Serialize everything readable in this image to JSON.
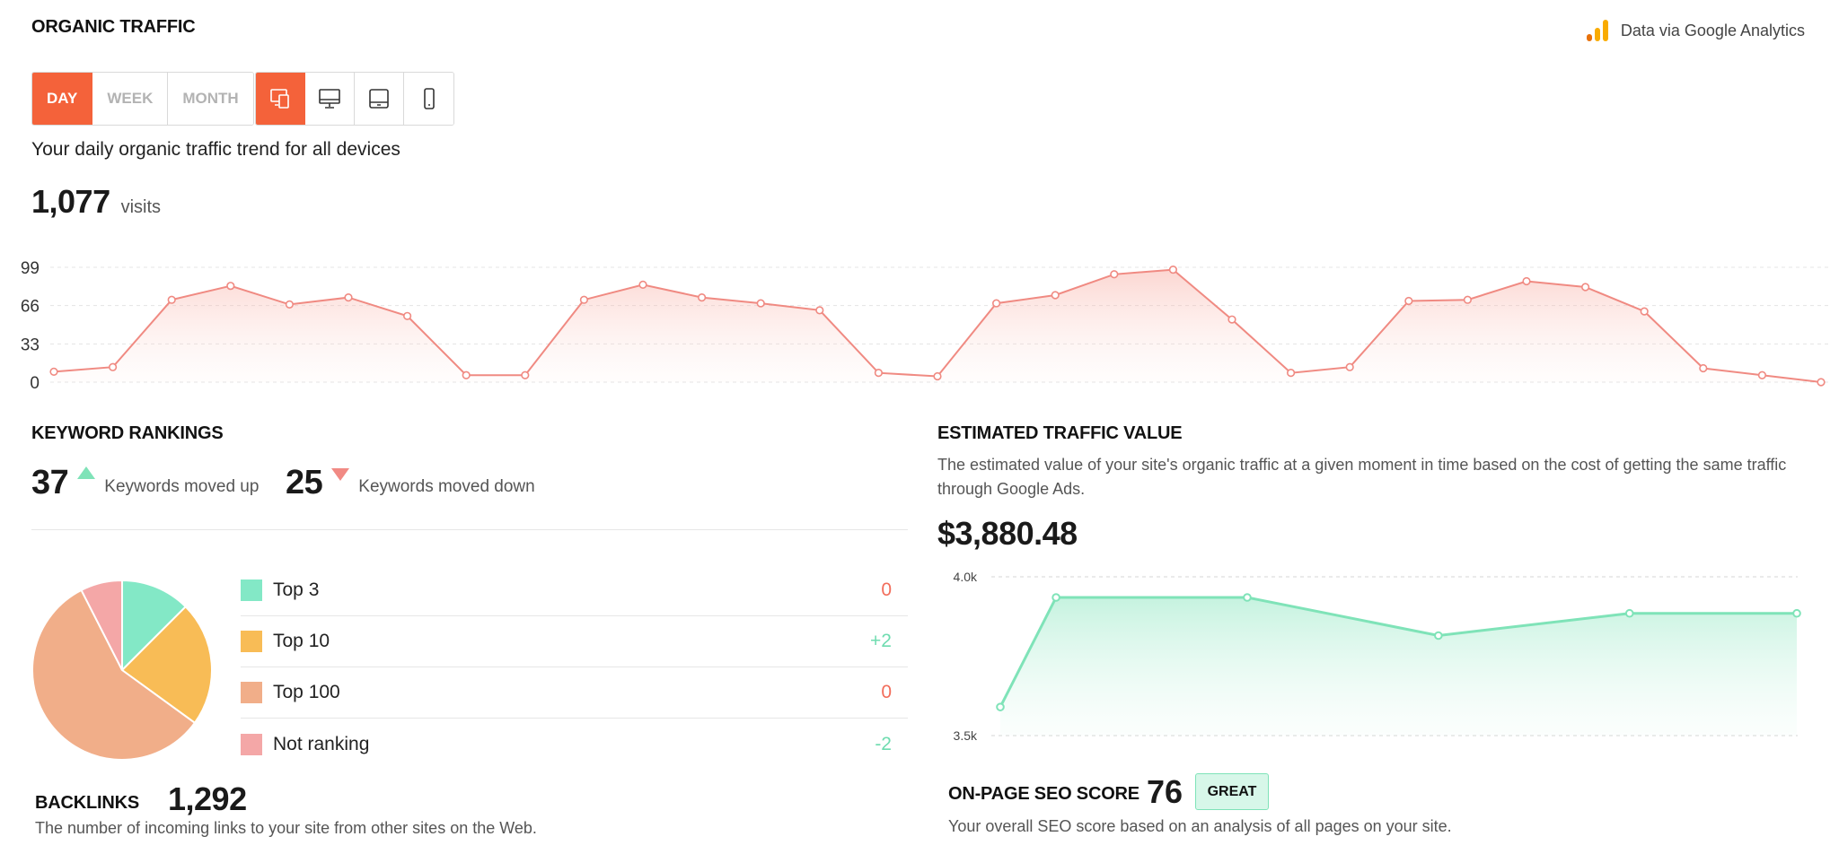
{
  "header": {
    "title": "ORGANIC TRAFFIC",
    "source_note": "Data via Google Analytics",
    "source_icon": "google-analytics-icon"
  },
  "period_tabs": [
    {
      "label": "DAY",
      "active": true
    },
    {
      "label": "WEEK",
      "active": false
    },
    {
      "label": "MONTH",
      "active": false
    }
  ],
  "device_tabs": [
    {
      "icon": "all-devices-icon",
      "active": true
    },
    {
      "icon": "desktop-icon",
      "active": false
    },
    {
      "icon": "tablet-icon",
      "active": false
    },
    {
      "icon": "mobile-icon",
      "active": false
    }
  ],
  "traffic": {
    "description": "Your daily organic traffic trend for all devices",
    "visits": "1,077",
    "visits_unit": "visits"
  },
  "keyword_rankings": {
    "title": "KEYWORD RANKINGS",
    "moved_up": {
      "count": "37",
      "label": "Keywords moved up"
    },
    "moved_down": {
      "count": "25",
      "label": "Keywords moved down"
    },
    "ranks": [
      {
        "label": "Top 3",
        "change": "0",
        "color": "#83e8c6",
        "change_color": "#f26d5b"
      },
      {
        "label": "Top 10",
        "change": "+2",
        "color": "#f8bc56",
        "change_color": "#6fdcb0"
      },
      {
        "label": "Top 100",
        "change": "0",
        "color": "#f1ae89",
        "change_color": "#f26d5b"
      },
      {
        "label": "Not ranking",
        "change": "-2",
        "color": "#f4a7a7",
        "change_color": "#6fdcb0"
      }
    ]
  },
  "backlinks": {
    "title": "BACKLINKS",
    "count": "1,292",
    "description": "The number of incoming links to your site from other sites on the Web."
  },
  "traffic_value": {
    "title": "ESTIMATED TRAFFIC VALUE",
    "description": "The estimated value of your site's organic traffic at a given moment in time based on the cost of getting the same traffic through Google Ads.",
    "value": "$3,880.48"
  },
  "seo": {
    "title": "ON-PAGE SEO SCORE",
    "score": "76",
    "badge": "GREAT",
    "description": "Your overall SEO score based on an analysis of all pages on your site."
  },
  "colors": {
    "accent": "#f4623a",
    "traffic_line": "#f08a82",
    "value_line": "#7fe3b8"
  },
  "chart_data": [
    {
      "type": "area",
      "ylim": [
        0,
        99
      ],
      "yticks": [
        "99",
        "66",
        "33",
        "0"
      ],
      "series": [
        {
          "values": [
            9,
            13,
            71,
            83,
            67,
            73,
            57,
            6,
            6,
            71,
            84,
            73,
            68,
            62,
            8,
            5,
            68,
            75,
            93,
            97,
            54,
            8,
            13,
            70,
            71,
            87,
            82,
            61,
            12,
            6,
            0
          ]
        }
      ]
    },
    {
      "type": "area",
      "ylim": [
        3500,
        4000
      ],
      "yticks": [
        "4.0k",
        "3.5k"
      ],
      "series": [
        {
          "values": [
            3590,
            3935,
            3935,
            3815,
            3885,
            3885
          ]
        }
      ],
      "x_positions": [
        0,
        0.07,
        0.31,
        0.55,
        0.79,
        1.0
      ]
    },
    {
      "type": "pie",
      "categories": [
        "Top 3",
        "Top 10",
        "Top 100",
        "Not ranking"
      ],
      "values": [
        12.5,
        22.5,
        57.5,
        7.5
      ]
    }
  ]
}
